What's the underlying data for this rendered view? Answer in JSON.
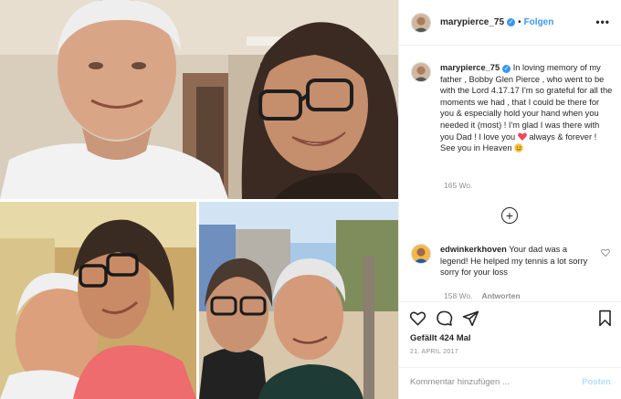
{
  "post": {
    "username": "marypierce_75",
    "verified_mark": "✓",
    "separator": "•",
    "follow_label": "Folgen",
    "more_label": "•••",
    "caption": {
      "username": "marypierce_75",
      "text_before_heart": " In loving memory of my father , Bobby Glen Pierce , who went to be with the Lord 4.17.17 I'm so grateful for all the moments we had , that I could be there for you & especially hold your hand when you needed it (most) ! I'm glad I was there with you Dad ! I love you ",
      "text_after_heart": " always & forever ! See you in Heaven ",
      "age": "165 Wo."
    },
    "load_more_label": "+",
    "reply": {
      "username": "edwinkerkhoven",
      "text": " Your dad was a legend! He helped my tennis a lot sorry sorry for your loss",
      "age": "158 Wo.",
      "answer_label": "Antworten"
    },
    "likes_text": "Gefällt 424 Mal",
    "date": "21. APRIL 2017",
    "comment_placeholder": "Kommentar hinzufügen ...",
    "post_label": "Posten"
  },
  "icons": {
    "header_avatar": "avatar-icon",
    "like": "heart-icon",
    "comment": "comment-icon",
    "share": "share-icon",
    "save": "bookmark-icon",
    "caption_heart": "red-heart-emoji",
    "caption_emoji": "smiling-face-emoji"
  },
  "colors": {
    "accent": "#3897f0",
    "post_disabled": "#b2dffc",
    "meta": "#8e8e8e",
    "heart": "#ed4956"
  }
}
